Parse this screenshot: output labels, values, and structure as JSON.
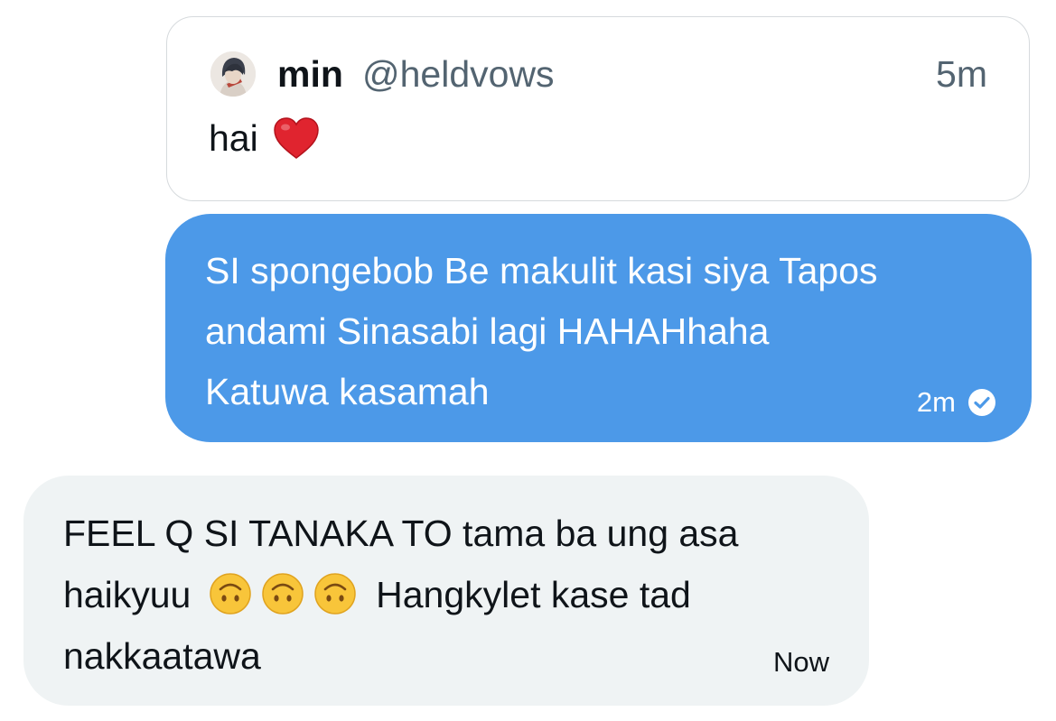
{
  "quoted_tweet": {
    "name": "min",
    "handle": "@heldvows",
    "time": "5m",
    "text": "hai",
    "emoji": "heart-icon"
  },
  "sent_message": {
    "line1": "SI spongebob Be makulit kasi siya Tapos",
    "line2": "andami Sinasabi lagi HAHAHhaha",
    "line3": "Katuwa kasamah",
    "time": "2m",
    "status_icon": "check-circle-icon",
    "color": "#4c99e8"
  },
  "received_message": {
    "line1": "FEEL Q SI TANAKA TO tama ba ung asa",
    "line2_prefix": "haikyuu",
    "line2_suffix": "Hangkylet kase tad",
    "line3": "nakkaatawa",
    "emoji": "upside-down-face-icon",
    "time": "Now",
    "color": "#eff3f4"
  }
}
